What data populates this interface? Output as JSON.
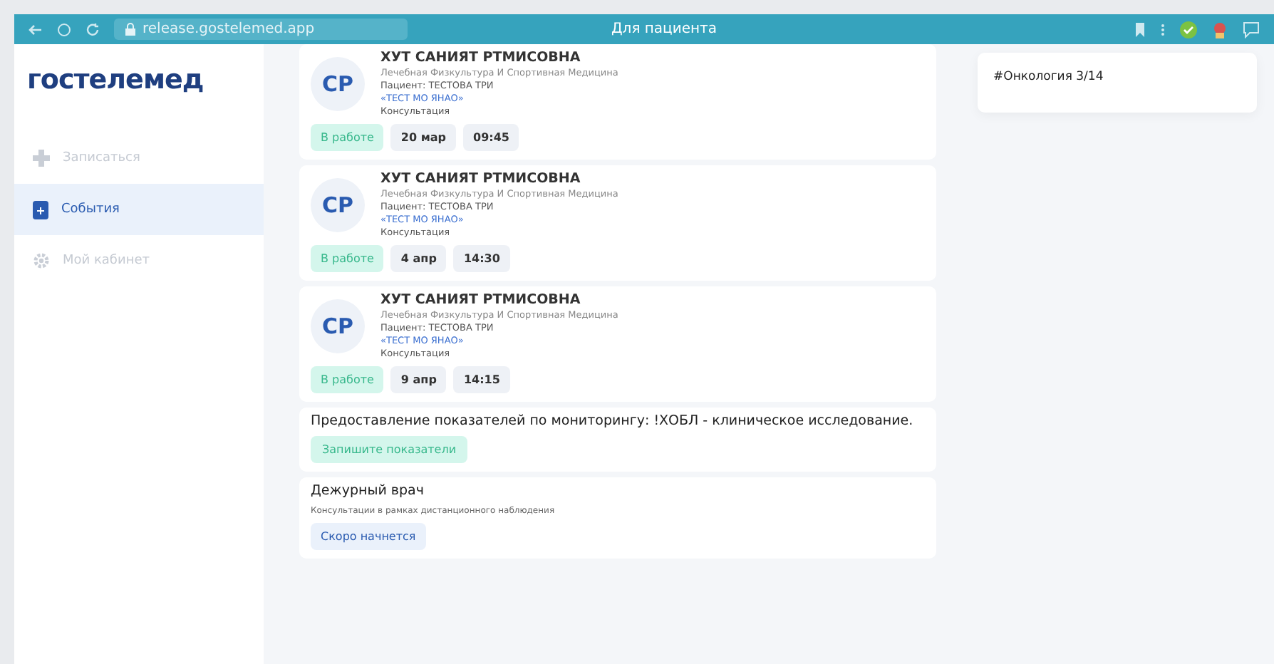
{
  "browser": {
    "url": "release.gostelemed.app",
    "title": "Для пациента"
  },
  "sidebar": {
    "logo": "гостелемед",
    "items": [
      {
        "label": "Записаться",
        "kind": "plus",
        "selected": false
      },
      {
        "label": "События",
        "kind": "doc",
        "selected": true
      },
      {
        "label": "Мой кабинет",
        "kind": "gear",
        "selected": false
      }
    ]
  },
  "events": [
    {
      "kind": "appointment",
      "initials": "СР",
      "doctor": "ХУТ САНИЯТ РТМИСОВНА",
      "specialty": "Лечебная Физкультура И Спортивная Медицина",
      "patient": "Пациент: ТЕСТОВА ТРИ",
      "clinic": "«ТЕСТ МО ЯНАО»",
      "type": "Консультация",
      "status": "В работе",
      "date": "20 мар",
      "time": "09:45"
    },
    {
      "kind": "appointment",
      "initials": "СР",
      "doctor": "ХУТ САНИЯТ РТМИСОВНА",
      "specialty": "Лечебная Физкультура И Спортивная Медицина",
      "patient": "Пациент: ТЕСТОВА ТРИ",
      "clinic": "«ТЕСТ МО ЯНАО»",
      "type": "Консультация",
      "status": "В работе",
      "date": "4 апр",
      "time": "14:30"
    },
    {
      "kind": "appointment",
      "initials": "СР",
      "doctor": "ХУТ САНИЯТ РТМИСОВНА",
      "specialty": "Лечебная Физкультура И Спортивная Медицина",
      "patient": "Пациент: ТЕСТОВА ТРИ",
      "clinic": "«ТЕСТ МО ЯНАО»",
      "type": "Консультация",
      "status": "В работе",
      "date": "9 апр",
      "time": "14:15"
    },
    {
      "kind": "monitoring",
      "title": "Предоставление показателей по мониторингу: !ХОБЛ - клиническое исследование.",
      "button": "Запишите показатели"
    },
    {
      "kind": "duty",
      "title": "Дежурный врач",
      "subtitle": "Консультации в рамках дистанционного наблюдения",
      "badge": "Скоро начнется"
    }
  ],
  "tags": [
    "#Онкология 3/14"
  ]
}
